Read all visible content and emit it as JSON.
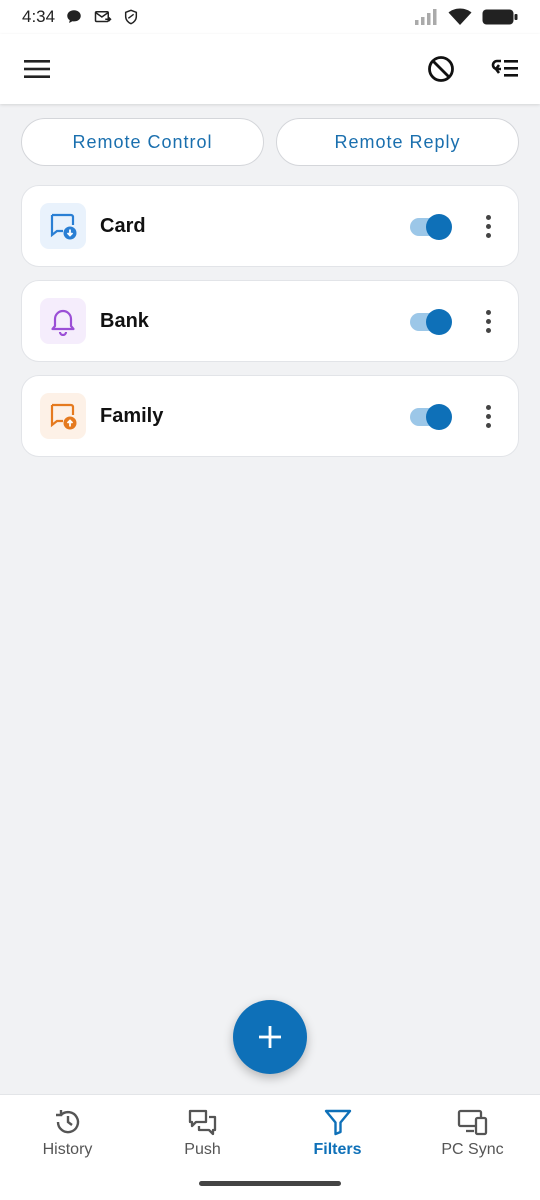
{
  "status": {
    "time": "4:34",
    "left_icons": [
      "chat-bubble-icon",
      "mail-forward-icon",
      "shield-icon"
    ],
    "right_icons": [
      "signal-icon",
      "wifi-icon",
      "battery-icon"
    ]
  },
  "app_bar": {
    "left_icon": "menu-icon",
    "right_icons": [
      "block-icon",
      "filter-list-icon"
    ]
  },
  "top_buttons": {
    "remote_control": "Remote Control",
    "remote_reply": "Remote Reply"
  },
  "filters": [
    {
      "name": "Card",
      "icon": "message-download-icon",
      "enabled": true,
      "accent": "#2a7fd4"
    },
    {
      "name": "Bank",
      "icon": "bell-icon",
      "enabled": true,
      "accent": "#9b4fd6"
    },
    {
      "name": "Family",
      "icon": "message-upload-icon",
      "enabled": true,
      "accent": "#e57a1f"
    }
  ],
  "fab": {
    "icon": "plus-icon",
    "label": "+"
  },
  "bottom_nav": [
    {
      "label": "History",
      "icon": "history-icon",
      "active": false
    },
    {
      "label": "Push",
      "icon": "chat-icon",
      "active": false
    },
    {
      "label": "Filters",
      "icon": "filter-icon",
      "active": true
    },
    {
      "label": "PC Sync",
      "icon": "devices-icon",
      "active": false
    }
  ],
  "colors": {
    "primary": "#0e70b8",
    "background": "#f1f2f4",
    "card": "#ffffff"
  }
}
